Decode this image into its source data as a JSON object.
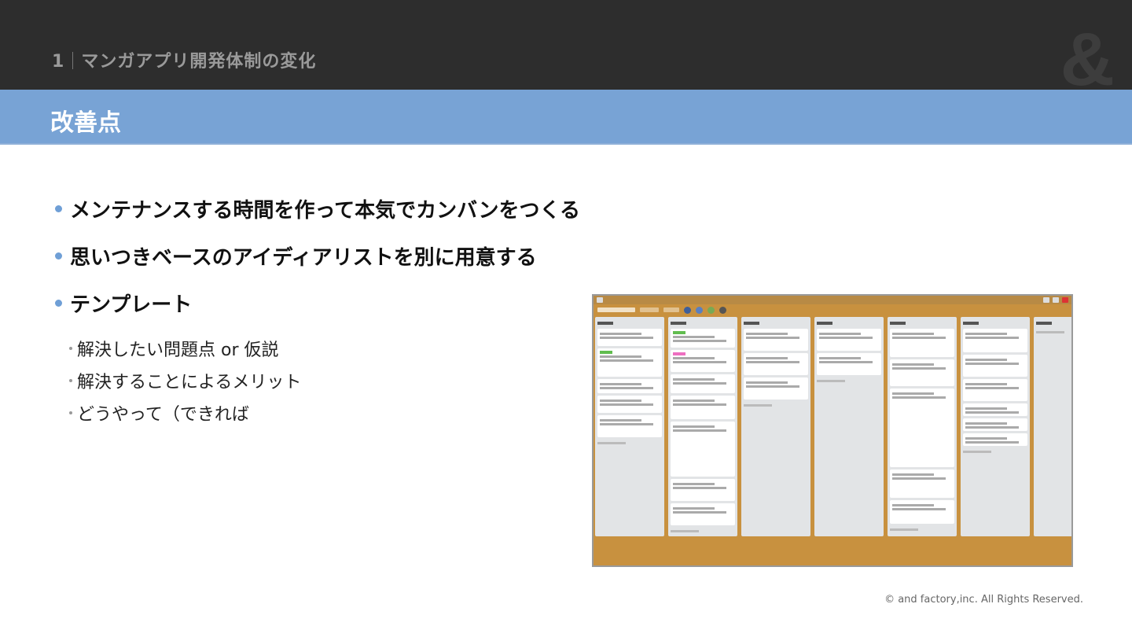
{
  "header": {
    "section_number": "1",
    "section_title": "マンガアプリ開発体制の変化",
    "logo": "&"
  },
  "title": "改善点",
  "bullets": [
    {
      "text": "メンテナンスする時間を作って本気でカンバンをつくる"
    },
    {
      "text": "思いつきベースのアイディアリストを別に用意する"
    },
    {
      "text": "テンプレート",
      "sub": [
        "解決したい問題点 or 仮説",
        "解決することによるメリット",
        "どうやって（できれば"
      ]
    }
  ],
  "screenshot": {
    "description_type": "kanban-board",
    "background_color": "#c8913f",
    "cards_per_list": [
      5,
      7,
      3,
      2,
      5,
      6,
      0
    ]
  },
  "footer": {
    "copyright": "© and factory,inc. All Rights Reserved."
  },
  "colors": {
    "topbar": "#2d2d2d",
    "titlebar": "#78a3d5",
    "bullet": "#6f9fd6"
  }
}
